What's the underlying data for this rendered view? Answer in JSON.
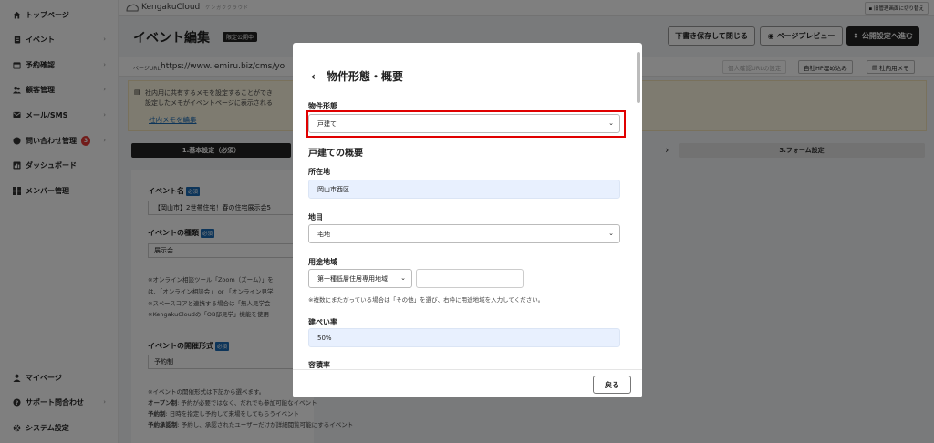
{
  "sidebar": {
    "items": [
      {
        "label": "トップページ",
        "icon": "home-icon",
        "arrow": ""
      },
      {
        "label": "イベント",
        "icon": "document-icon",
        "arrow": "›"
      },
      {
        "label": "予約確認",
        "icon": "calendar-icon",
        "arrow": "›"
      },
      {
        "label": "顧客管理",
        "icon": "users-icon",
        "arrow": "›"
      },
      {
        "label": "メール/SMS",
        "icon": "mail-icon",
        "arrow": "›"
      },
      {
        "label": "問い合わせ管理",
        "icon": "chat-icon",
        "arrow": "›",
        "badge": "3"
      },
      {
        "label": "ダッシュボード",
        "icon": "chart-icon",
        "arrow": ""
      },
      {
        "label": "メンバー管理",
        "icon": "grid-icon",
        "arrow": ""
      }
    ],
    "bottom_items": [
      {
        "label": "マイページ",
        "icon": "person-icon",
        "arrow": ""
      },
      {
        "label": "サポート問合わせ",
        "icon": "help-icon",
        "arrow": "›"
      },
      {
        "label": "システム設定",
        "icon": "gear-icon",
        "arrow": ""
      }
    ]
  },
  "topbar": {
    "logo_text": "KengakuCloud",
    "logo_sub": "ケンガククラウド",
    "switch_label": "旧管理画面に切り替え"
  },
  "header": {
    "title": "イベント編集",
    "status_tag": "限定公開中",
    "save_draft": "下書き保存して閉じる",
    "preview": "ページプレビュー",
    "publish": "公開設定へ進む"
  },
  "url_bar": {
    "label": "ページURL",
    "value": "https://www.iemiru.biz/cms/yo",
    "btn_muted": "個人確認URLの設定",
    "btn_embed": "自社HP埋め込み",
    "btn_memo": "社内用メモ"
  },
  "memo": {
    "line1": "社内用に共有するメモを設定することができ",
    "line2": "設定したメモがイベントページに表示される",
    "link": "社内メモを編集"
  },
  "steps": {
    "step1": "1.基本設定（必須）",
    "step3": "3.フォーム設定",
    "separator": "›"
  },
  "form": {
    "event_name_label": "イベント名",
    "event_name_value": "【岡山市】2世帯住宅！春の住宅展示会5",
    "required": "必須",
    "event_type_label": "イベントの種類",
    "event_type_value": "展示会",
    "notes": [
      "※オンライン相談ツール「Zoom（ズーム）」を",
      "は、「オンライン相談会」 or 「オンライン見学",
      "※スペースコアと連携する場合は「無人見学会",
      "※KengakuCloudの「OB邸見学」機能を使用"
    ],
    "format_label": "イベントの開催形式",
    "format_value": "予約制",
    "format_notes": {
      "intro": "※イベントの開催形式は下記から選べます。",
      "open_head": "オープン制",
      "open_text": ": 予約が必要ではなく、だれでも参加可能なイベント",
      "reserve_head": "予約制",
      "reserve_text": ": 日時を指定し予約して来場をしてもらうイベント",
      "approve_head": "予約承認制",
      "approve_text": ": 予約し、承認されたユーザーだけが詳細閲覧可能にするイベント"
    }
  },
  "modal": {
    "title": "物件形態・概要",
    "back_chevron": "‹",
    "property_type_label": "物件形態",
    "property_type_value": "戸建て",
    "section_title": "戸建ての概要",
    "address_label": "所在地",
    "address_value": "岡山市西区",
    "land_category_label": "地目",
    "land_category_value": "宅地",
    "zoning_label": "用途地域",
    "zoning_value": "第一種低層住居専用地域",
    "zoning_other_value": "",
    "zoning_note": "※複数にまたがっている場合は「その他」を選び、右枠に用途地域を入力してください。",
    "coverage_label": "建ぺい率",
    "coverage_value": "50%",
    "far_label": "容積率",
    "back_button": "戻る"
  }
}
